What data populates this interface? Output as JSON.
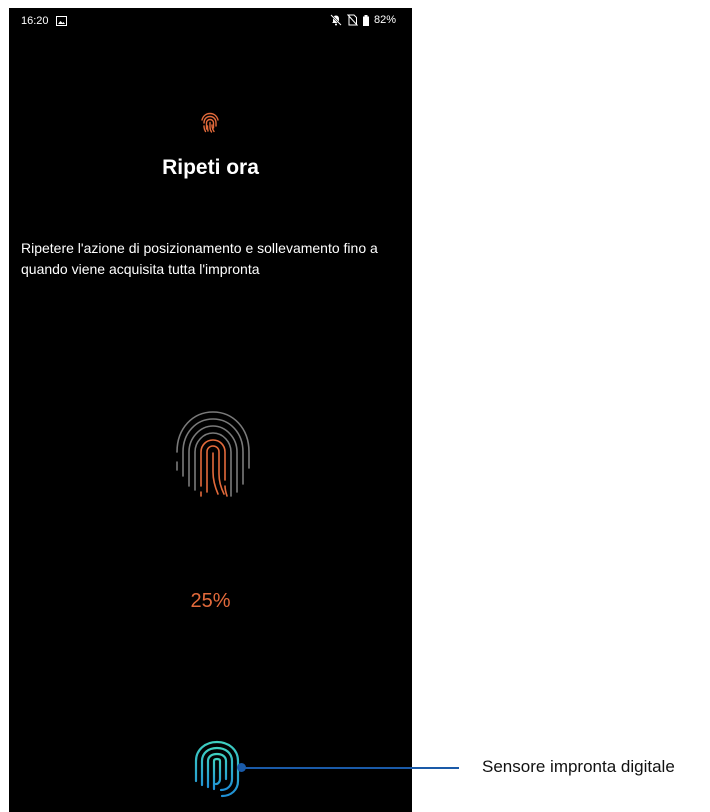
{
  "status_bar": {
    "time": "16:20",
    "battery": "82%",
    "icons": [
      "gallery-icon",
      "notifications-off-icon",
      "no-sim-icon",
      "battery-icon"
    ]
  },
  "screen": {
    "title": "Ripeti ora",
    "instructions": "Ripetere l'azione di posizionamento e sollevamento fino a quando viene acquisita tutta l'impronta",
    "progress_label": "25%",
    "progress_value": 0.25,
    "icons": [
      "fingerprint-header-icon",
      "fingerprint-progress-icon",
      "fingerprint-sensor-icon"
    ]
  },
  "callout": {
    "label": "Sensore impronta digitale"
  },
  "colors": {
    "background": "#000000",
    "text": "#ffffff",
    "accent_orange": "#e36a3b",
    "sensor_cyan": "#2ac6c9",
    "callout_blue": "#1a5aa8"
  }
}
